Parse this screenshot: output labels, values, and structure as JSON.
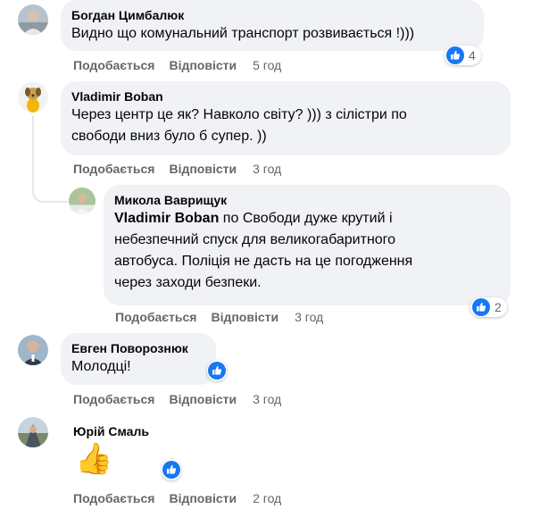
{
  "labels": {
    "like": "Подобається",
    "reply": "Відповісти"
  },
  "comments": [
    {
      "author": "Богдан Цимбалюк",
      "text": "Видно що комунальний транспорт розвивається !)))",
      "time": "5 год",
      "reactions": "4"
    },
    {
      "author": "Vladimir Boban",
      "text_line1": "Через центр це як? Навколо світу? ))) з сілістри по",
      "text_line2": "свободи вниз було б супер. ))",
      "time": "3 год"
    },
    {
      "author": "Микола Ваврищук",
      "mention": "Vladimir Boban",
      "text_line1": " по Свободи дуже крутий і",
      "text_line2": "небезпечний спуск для великогабаритного",
      "text_line3": "автобуса. Поліція не дасть на це погодження",
      "text_line4": "через заходи безпеки.",
      "time": "3 год",
      "reactions": "2"
    },
    {
      "author": "Евген Поворознюк",
      "text": "Молодці!",
      "time": "3 год"
    },
    {
      "author": "Юрій Смаль",
      "emoji": "👍",
      "time": "2 год"
    }
  ],
  "colors": {
    "bubble": "#f0f2f5",
    "like_blue": "#1877f2",
    "meta_grey": "#65676b",
    "thread_line": "#e4e6eb"
  },
  "icons": {
    "reaction": "like-icon",
    "sticker": "thumbs-up-emoji"
  }
}
